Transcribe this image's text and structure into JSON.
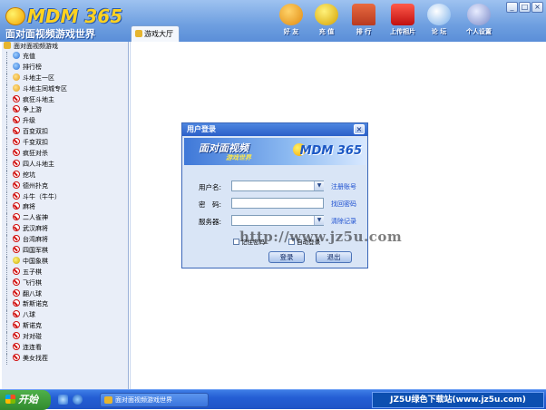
{
  "app": {
    "logo_text": "MDM 365",
    "logo_subtitle": "面对面视频游戏世界"
  },
  "tabs": [
    {
      "label": "游戏大厅"
    }
  ],
  "topnav": [
    {
      "label": "好 友",
      "icon": "friends-icon",
      "color": "#f0a020"
    },
    {
      "label": "充 值",
      "icon": "coins-icon",
      "color": "#f2c200"
    },
    {
      "label": "排 行",
      "icon": "house-icon",
      "color": "#e05030"
    },
    {
      "label": "上传相片",
      "icon": "camera-icon",
      "color": "#d82020"
    },
    {
      "label": "论 坛",
      "icon": "chat-icon",
      "color": "#6aa8e8"
    },
    {
      "label": "个人设置",
      "icon": "user-settings-icon",
      "color": "#8a9ad0"
    }
  ],
  "window_controls": [
    "_",
    "□",
    "×"
  ],
  "sidebar": {
    "root_label": "面对面视频游戏",
    "items": [
      {
        "label": "充值",
        "icon": "globe"
      },
      {
        "label": "排行榜",
        "icon": "globe"
      },
      {
        "label": "斗地主一区",
        "icon": "face"
      },
      {
        "label": "斗地主同城专区",
        "icon": "face"
      },
      {
        "label": "疯狂斗地主",
        "icon": "no"
      },
      {
        "label": "争上游",
        "icon": "no"
      },
      {
        "label": "升级",
        "icon": "no"
      },
      {
        "label": "百变双扣",
        "icon": "no"
      },
      {
        "label": "千变双扣",
        "icon": "no"
      },
      {
        "label": "疯狂对杀",
        "icon": "no"
      },
      {
        "label": "四人斗地主",
        "icon": "no"
      },
      {
        "label": "挖坑",
        "icon": "no"
      },
      {
        "label": "德州扑克",
        "icon": "no"
      },
      {
        "label": "斗牛（牛牛）",
        "icon": "no"
      },
      {
        "label": "麻将",
        "icon": "no"
      },
      {
        "label": "二人雀神",
        "icon": "no"
      },
      {
        "label": "武汉麻将",
        "icon": "no"
      },
      {
        "label": "台湾麻将",
        "icon": "no"
      },
      {
        "label": "四国军棋",
        "icon": "no"
      },
      {
        "label": "中国象棋",
        "icon": "star"
      },
      {
        "label": "五子棋",
        "icon": "no"
      },
      {
        "label": "飞行棋",
        "icon": "no"
      },
      {
        "label": "翻八球",
        "icon": "no"
      },
      {
        "label": "新斯诺克",
        "icon": "no"
      },
      {
        "label": "八球",
        "icon": "no"
      },
      {
        "label": "斯诺克",
        "icon": "no"
      },
      {
        "label": "对对碰",
        "icon": "no"
      },
      {
        "label": "连连看",
        "icon": "no"
      },
      {
        "label": "美女找茬",
        "icon": "no"
      }
    ]
  },
  "login_dialog": {
    "title": "用户登录",
    "banner_text": "面对面视频",
    "banner_sub": "游戏世界",
    "banner_logo": "MDM 365",
    "username_label": "用户名:",
    "username_value": "",
    "register_link": "注册账号",
    "password_label": "密　码:",
    "password_value": "",
    "forgot_link": "找回密码",
    "server_label": "服务器:",
    "server_value": "",
    "clear_link": "清除记录",
    "remember_label": "记住密码",
    "auto_label": "自动登录",
    "login_button": "登录",
    "exit_button": "退出"
  },
  "watermark": "http://www.jz5u.com",
  "taskbar": {
    "start_label": "开始",
    "task_label": "面对面视频游戏世界",
    "tray_text": "JZ5U绿色下载站(www.jz5u.com)"
  }
}
